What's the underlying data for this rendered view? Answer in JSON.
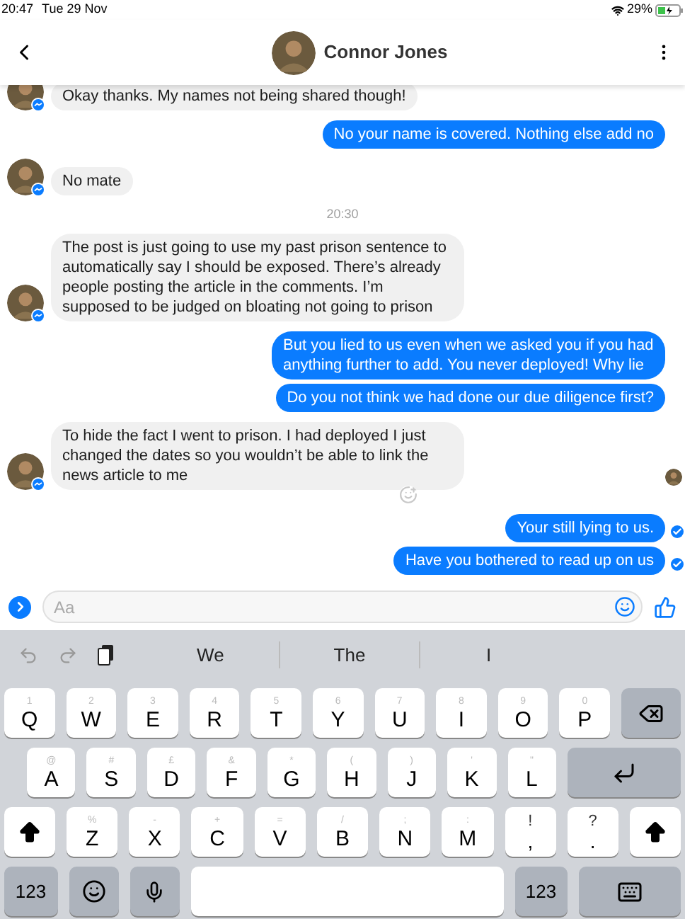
{
  "status_bar": {
    "time": "20:47",
    "date": "Tue 29 Nov",
    "battery": "29%",
    "charging": true
  },
  "header": {
    "title": "Connor Jones"
  },
  "messages": [
    {
      "kind": "incoming",
      "text": "Okay thanks. My names not being shared though!",
      "react_button": false
    },
    {
      "kind": "outgoing",
      "text": "No your name is covered. Nothing else add no",
      "delivered": false
    },
    {
      "kind": "incoming",
      "text": "No mate",
      "react_button": false
    },
    {
      "kind": "time",
      "text": "20:30"
    },
    {
      "kind": "incoming",
      "text": "The post is just going to use my past prison sentence to automatically say I should be exposed. There’s already people posting the article in the comments. I’m supposed to be judged on bloating not going to prison",
      "react_button": false
    },
    {
      "kind": "outgoing",
      "text": "But you lied to us even when we asked you if you had anything further to add. You never deployed! Why lie",
      "delivered": false
    },
    {
      "kind": "outgoing",
      "text": "Do you not think we had done our due diligence first?",
      "delivered": false
    },
    {
      "kind": "incoming",
      "text": "To hide the fact I went to prison. I had deployed I just changed the dates so you wouldn’t be able to link the news article to me",
      "react_button": true
    },
    {
      "kind": "seen"
    },
    {
      "kind": "outgoing",
      "text": "Your still lying to us.",
      "delivered": true
    },
    {
      "kind": "outgoing",
      "text": "Have you bothered to read up on us",
      "delivered": true
    }
  ],
  "composer": {
    "placeholder": "Aa"
  },
  "suggestions": [
    "We",
    "The",
    "I"
  ],
  "keyboard": {
    "rows": [
      {
        "keys": [
          {
            "kind": "letter",
            "main": "Q",
            "alt": "1"
          },
          {
            "kind": "letter",
            "main": "W",
            "alt": "2"
          },
          {
            "kind": "letter",
            "main": "E",
            "alt": "3"
          },
          {
            "kind": "letter",
            "main": "R",
            "alt": "4"
          },
          {
            "kind": "letter",
            "main": "T",
            "alt": "5"
          },
          {
            "kind": "letter",
            "main": "Y",
            "alt": "6"
          },
          {
            "kind": "letter",
            "main": "U",
            "alt": "7"
          },
          {
            "kind": "letter",
            "main": "I",
            "alt": "8"
          },
          {
            "kind": "letter",
            "main": "O",
            "alt": "9"
          },
          {
            "kind": "letter",
            "main": "P",
            "alt": "0"
          },
          {
            "kind": "backspace"
          }
        ]
      },
      {
        "keys": [
          {
            "kind": "letter",
            "main": "A",
            "alt": "@"
          },
          {
            "kind": "letter",
            "main": "S",
            "alt": "#"
          },
          {
            "kind": "letter",
            "main": "D",
            "alt": "£"
          },
          {
            "kind": "letter",
            "main": "F",
            "alt": "&"
          },
          {
            "kind": "letter",
            "main": "G",
            "alt": "*"
          },
          {
            "kind": "letter",
            "main": "H",
            "alt": "("
          },
          {
            "kind": "letter",
            "main": "J",
            "alt": ")"
          },
          {
            "kind": "letter",
            "main": "K",
            "alt": "'"
          },
          {
            "kind": "letter",
            "main": "L",
            "alt": "\""
          },
          {
            "kind": "return"
          }
        ]
      },
      {
        "keys": [
          {
            "kind": "shift"
          },
          {
            "kind": "letter",
            "main": "Z",
            "alt": "%"
          },
          {
            "kind": "letter",
            "main": "X",
            "alt": "-"
          },
          {
            "kind": "letter",
            "main": "C",
            "alt": "+"
          },
          {
            "kind": "letter",
            "main": "V",
            "alt": "="
          },
          {
            "kind": "letter",
            "main": "B",
            "alt": "/"
          },
          {
            "kind": "letter",
            "main": "N",
            "alt": ";"
          },
          {
            "kind": "letter",
            "main": "M",
            "alt": ":"
          },
          {
            "kind": "punct",
            "main": ",",
            "alt": "!"
          },
          {
            "kind": "punct",
            "main": ".",
            "alt": "?"
          },
          {
            "kind": "shift"
          }
        ]
      },
      {
        "keys": [
          {
            "kind": "mode",
            "label": "123"
          },
          {
            "kind": "emoji"
          },
          {
            "kind": "mic"
          },
          {
            "kind": "space"
          },
          {
            "kind": "mode",
            "label": "123"
          },
          {
            "kind": "hide"
          }
        ]
      }
    ]
  }
}
